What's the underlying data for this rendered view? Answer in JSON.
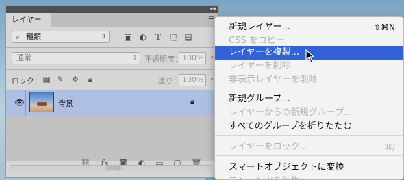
{
  "panel": {
    "tab_label": "レイヤー",
    "tab_close": "×",
    "collapse": "◂◂",
    "filter": {
      "selected": "種類",
      "icons": [
        "image-filter-icon",
        "adjustment-filter-icon",
        "type-filter-icon",
        "shape-filter-icon",
        "smart-object-filter-icon"
      ],
      "type_glyph": "T"
    },
    "blend_mode": "通常",
    "opacity_label": "不透明度：",
    "opacity_value": "100%",
    "lock_label": "ロック：",
    "fill_label": "塗り：",
    "fill_value": "100%",
    "layers": [
      {
        "name": "背景",
        "visible": true,
        "locked": true
      }
    ],
    "grip": "||||||||",
    "footer_icons": [
      "link-icon",
      "fx-icon",
      "mask-icon",
      "adjustment-icon",
      "folder-icon",
      "new-layer-icon",
      "trash-icon"
    ],
    "fx_text": "fx"
  },
  "menu": {
    "items": [
      {
        "label": "新規レイヤー...",
        "shortcut": "⇧⌘N",
        "state": "enabled"
      },
      {
        "label": "CSS をコピー",
        "shortcut": "",
        "state": "disabled"
      },
      {
        "label": "レイヤーを複製...",
        "shortcut": "",
        "state": "highlighted"
      },
      {
        "label": "レイヤーを削除",
        "shortcut": "",
        "state": "disabled"
      },
      {
        "label": "非表示レイヤーを削除",
        "shortcut": "",
        "state": "disabled"
      },
      {
        "label": "新規グループ...",
        "shortcut": "",
        "state": "enabled"
      },
      {
        "label": "レイヤーからの新規グループ...",
        "shortcut": "",
        "state": "disabled"
      },
      {
        "label": "すべてのグループを折りたたむ",
        "shortcut": "",
        "state": "enabled"
      },
      {
        "label": "レイヤーをロック...",
        "shortcut": "⌘/",
        "state": "disabled"
      },
      {
        "label": "スマートオブジェクトに変換",
        "shortcut": "",
        "state": "enabled"
      },
      {
        "label": "コンテンツを編集",
        "shortcut": "",
        "state": "disabled"
      }
    ]
  },
  "colors": {
    "highlight": "#3262d8",
    "selected_layer": "#aebfe4"
  }
}
